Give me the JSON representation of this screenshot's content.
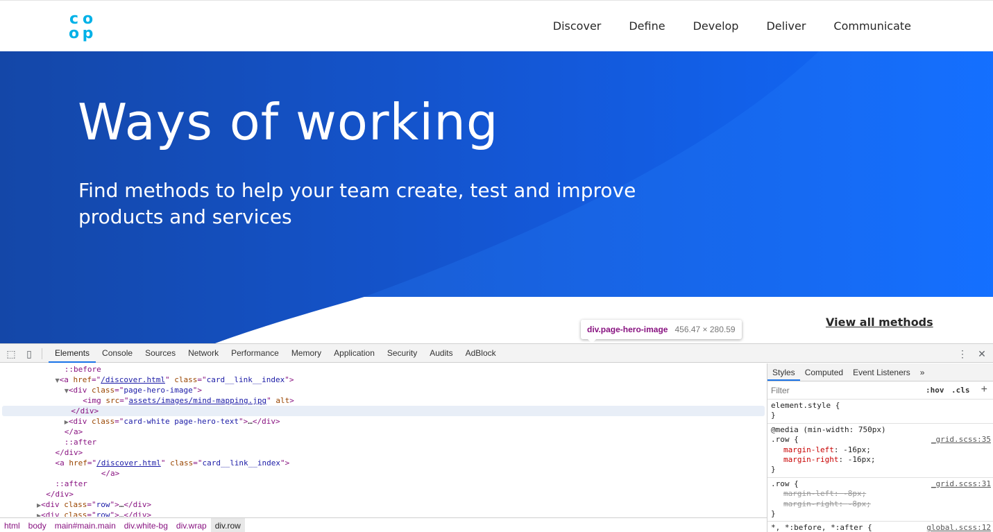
{
  "site": {
    "logo_letters": [
      "c",
      "o",
      "o",
      "p"
    ],
    "nav": [
      "Discover",
      "Define",
      "Develop",
      "Deliver",
      "Communicate"
    ],
    "hero_title": "Ways of working",
    "hero_subtitle_line1": "Find methods to help your team create, test and improve",
    "hero_subtitle_line2": "products and services",
    "view_all": "View all methods",
    "colors": {
      "hero_dark": "#1447a8",
      "hero_light": "#0f6bff",
      "brand": "#00b1e7"
    }
  },
  "tooltip": {
    "name": "div.page-hero-image",
    "size": "456.47 × 280.59"
  },
  "devtools": {
    "tabs": [
      "Elements",
      "Console",
      "Sources",
      "Network",
      "Performance",
      "Memory",
      "Application",
      "Security",
      "Audits",
      "AdBlock"
    ],
    "active_tab": "Elements",
    "dom": {
      "l0": "::before",
      "l1_href": "/discover.html",
      "l1_class": "card__link__index",
      "l2_class": "page-hero-image",
      "l3_src": "assets/images/mind-mapping.jpg",
      "l5_class": "card-white page-hero-text",
      "l9_href": "/discover.html",
      "l9_class": "card__link__index",
      "row_class": "row"
    },
    "breadcrumbs": [
      "html",
      "body",
      "main#main.main",
      "div.white-bg",
      "div.wrap",
      "div.row"
    ],
    "styles_tabs": [
      "Styles",
      "Computed",
      "Event Listeners"
    ],
    "filter_placeholder": "Filter",
    "hov": ":hov",
    "cls": ".cls",
    "rules": {
      "element_style": "element.style {",
      "media": "@media (min-width: 750px)",
      "row_sel": ".row {",
      "src1": "_grid.scss:35",
      "src2": "_grid.scss:31",
      "src3": "global.scss:12",
      "ml16": "margin-left",
      "ml16v": "-16px;",
      "mr16": "margin-right",
      "mr16v": "-16px;",
      "ml8v": "-8px;",
      "mr8v": "-8px;",
      "universal": "*, *:before, *:after {"
    }
  }
}
